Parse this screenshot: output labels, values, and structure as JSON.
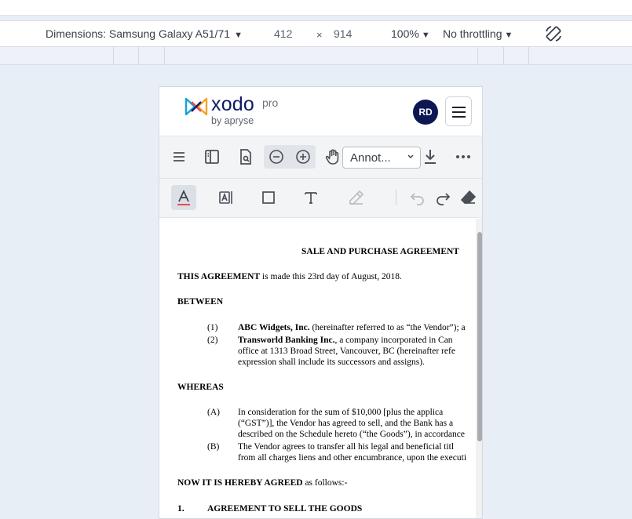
{
  "devtools": {
    "device_label": "Dimensions: Samsung Galaxy A51/71",
    "width": "412",
    "times": "×",
    "height": "914",
    "zoom": "100%",
    "throttling": "No throttling"
  },
  "app": {
    "logo_word": "xodo",
    "logo_pro": "pro",
    "logo_by": "by apryse",
    "avatar_initials": "RD",
    "annotation_mode": "Annot..."
  },
  "document": {
    "title": "SALE AND PURCHASE AGREEMENT",
    "intro_bold": "THIS AGREEMENT",
    "intro_rest": " is made this 23rd day of August, 2018.",
    "between": "BETWEEN",
    "parties": [
      {
        "num": "(1)",
        "bold": "ABC Widgets, Inc.",
        "rest": " (hereinafter referred to as “the Vendor”); a",
        "extra": []
      },
      {
        "num": "(2)",
        "bold": "Transworld Banking Inc.",
        "rest": ", a company incorporated in Can",
        "extra": [
          "office at 1313 Broad Street, Vancouver, BC (hereinafter refe",
          "expression shall include its successors and assigns)."
        ]
      }
    ],
    "whereas": "WHEREAS",
    "recitals": [
      {
        "num": "(A)",
        "lines": [
          "In consideration for the sum of $10,000 [plus the applica",
          "(“GST”)], the Vendor has agreed to sell, and the Bank has a",
          "described on the Schedule hereto (“the Goods”), in accordance"
        ]
      },
      {
        "num": "(B)",
        "lines": [
          "The Vendor agrees to transfer all his legal and beneficial titl",
          "from all charges liens and other encumbrance, upon the executi"
        ]
      }
    ],
    "agreed_bold": "NOW IT IS HEREBY AGREED",
    "agreed_rest": " as follows:-",
    "section_num": "1.",
    "section_title": "AGREEMENT TO SELL THE GOODS"
  },
  "colors": {
    "brand_navy": "#0d1b63",
    "avatar_bg": "#0d1752",
    "active_tool_bg": "#dbe0e6",
    "text_underline_red": "#e44c4c"
  },
  "icons": [
    "rotate-icon",
    "hamburger-icon",
    "panel-icon",
    "file-search-icon",
    "zoom-out-icon",
    "zoom-in-icon",
    "pan-hand-icon",
    "download-icon",
    "more-icon",
    "text-highlight-icon",
    "free-text-icon",
    "rectangle-icon",
    "text-icon",
    "signature-icon",
    "undo-icon",
    "redo-icon",
    "eraser-icon"
  ]
}
